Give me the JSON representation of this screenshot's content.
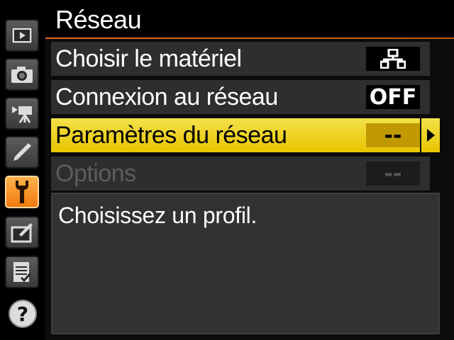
{
  "title": "Réseau",
  "sidebar": {
    "tabs": [
      {
        "icon": "playback-icon",
        "active": false
      },
      {
        "icon": "camera-icon",
        "active": false
      },
      {
        "icon": "movie-icon",
        "active": false
      },
      {
        "icon": "pencil-icon",
        "active": false
      },
      {
        "icon": "wrench-icon",
        "active": true
      },
      {
        "icon": "retouch-icon",
        "active": false
      },
      {
        "icon": "my-menu-icon",
        "active": false
      }
    ],
    "help_label": "?"
  },
  "menu": {
    "items": [
      {
        "label": "Choisir le matériel",
        "value_icon": "network-icon",
        "state": "normal"
      },
      {
        "label": "Connexion au réseau",
        "value": "OFF",
        "state": "normal"
      },
      {
        "label": "Paramètres du réseau",
        "value": "--",
        "state": "selected"
      },
      {
        "label": "Options",
        "value": "--",
        "state": "disabled"
      }
    ]
  },
  "help": {
    "text": "Choisissez un profil."
  },
  "colors": {
    "accent_orange": "#f07a10",
    "selected_yellow": "#f4e24a"
  }
}
